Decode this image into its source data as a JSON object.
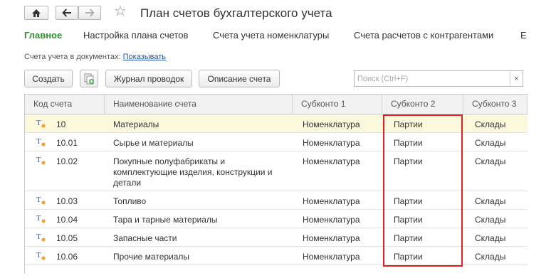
{
  "window": {
    "title": "План счетов бухгалтерского учета"
  },
  "tabs": [
    {
      "label": "Главное",
      "active": true
    },
    {
      "label": "Настройка плана счетов"
    },
    {
      "label": "Счета учета номенклатуры"
    },
    {
      "label": "Счета расчетов с контрагентами"
    },
    {
      "label": "Е"
    }
  ],
  "accounts_in_documents": {
    "label": "Счета учета в документах:",
    "link": "Показывать"
  },
  "toolbar": {
    "create_label": "Создать",
    "journal_label": "Журнал проводок",
    "description_label": "Описание счета",
    "search_placeholder": "Поиск (Ctrl+F)",
    "clear_label": "×"
  },
  "table": {
    "columns": [
      "Код счета",
      "Наименование счета",
      "Субконто 1",
      "Субконто 2",
      "Субконто 3"
    ],
    "rows": [
      {
        "code": "10",
        "name": "Материалы",
        "s1": "Номенклатура",
        "s2": "Партии",
        "s3": "Склады"
      },
      {
        "code": "10.01",
        "name": "Сырье и материалы",
        "s1": "Номенклатура",
        "s2": "Партии",
        "s3": "Склады"
      },
      {
        "code": "10.02",
        "name_lines": [
          "Покупные полуфабрикаты и",
          "комплектующие изделия, конструкции и",
          "детали"
        ],
        "s1": "Номенклатура",
        "s2": "Партии",
        "s3": "Склады"
      },
      {
        "code": "10.03",
        "name": "Топливо",
        "s1": "Номенклатура",
        "s2": "Партии",
        "s3": "Склады"
      },
      {
        "code": "10.04",
        "name": "Тара и тарные материалы",
        "s1": "Номенклатура",
        "s2": "Партии",
        "s3": "Склады"
      },
      {
        "code": "10.05",
        "name": "Запасные части",
        "s1": "Номенклатура",
        "s2": "Партии",
        "s3": "Склады"
      },
      {
        "code": "10.06",
        "name": "Прочие материалы",
        "s1": "Номенклатура",
        "s2": "Партии",
        "s3": "Склады"
      }
    ]
  },
  "colors": {
    "accent_green": "#2f8f2f",
    "link_blue": "#2255b0",
    "highlight_red": "#e02020",
    "selected_row": "#fbf8dc"
  },
  "icons": {
    "home": "home-icon",
    "back": "arrow-left-icon",
    "forward": "arrow-right-icon",
    "favorite": "star-icon",
    "account": "account-type-icon",
    "copy": "copy-add-icon"
  }
}
